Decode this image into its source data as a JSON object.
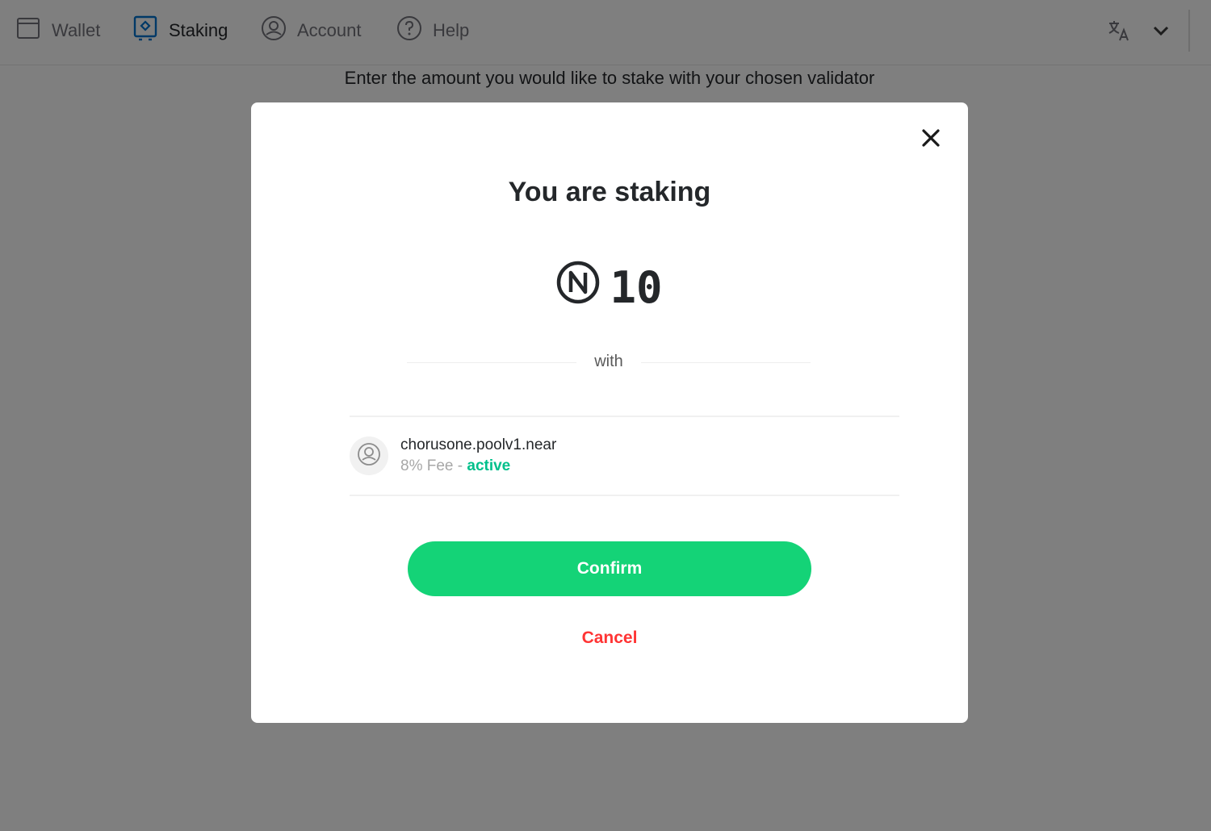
{
  "nav": {
    "items": [
      {
        "label": "Wallet",
        "icon": "wallet-icon"
      },
      {
        "label": "Staking",
        "icon": "staking-icon",
        "active": true
      },
      {
        "label": "Account",
        "icon": "account-icon"
      },
      {
        "label": "Help",
        "icon": "help-icon"
      }
    ],
    "language_icon": "translate-icon"
  },
  "background": {
    "instruction": "Enter the amount you would like to stake with your chosen validator"
  },
  "modal": {
    "title": "You are staking",
    "amount": "10",
    "currency_icon": "near-icon",
    "with_label": "with",
    "validator": {
      "name": "chorusone.poolv1.near",
      "fee": "8% Fee",
      "separator": " - ",
      "status": "active"
    },
    "confirm_label": "Confirm",
    "cancel_label": "Cancel"
  },
  "colors": {
    "accent_green": "#14d377",
    "status_green": "#00c08b",
    "cancel_red": "#ff3434",
    "staking_blue": "#0072ce"
  }
}
